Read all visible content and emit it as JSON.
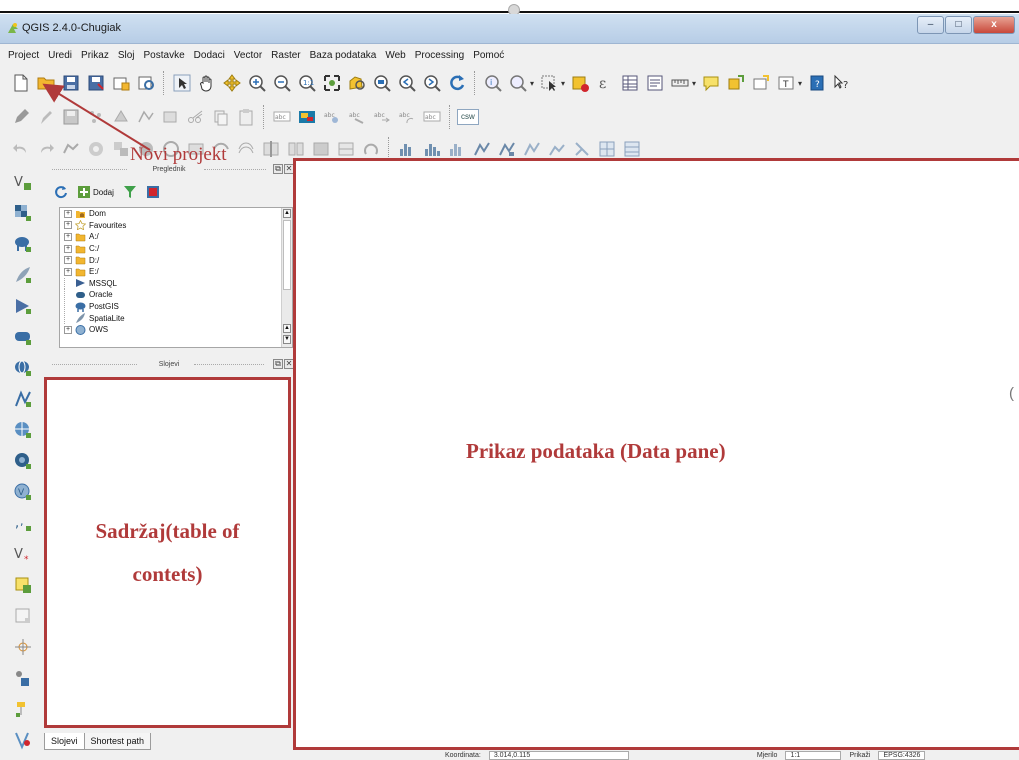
{
  "window": {
    "title": "QGIS 2.4.0-Chugiak",
    "controls": {
      "minimize": "–",
      "maximize": "□",
      "close": "x"
    }
  },
  "menu": [
    "Project",
    "Uredi",
    "Prikaz",
    "Sloj",
    "Postavke",
    "Dodaci",
    "Vector",
    "Raster",
    "Baza podataka",
    "Web",
    "Processing",
    "Pomoć"
  ],
  "toolbar": {
    "csw_label": "csw"
  },
  "browser_panel": {
    "title": "Preglednik",
    "add_label": "Dodaj",
    "items": [
      {
        "label": "Dom",
        "icon": "home-folder-icon",
        "expandable": true
      },
      {
        "label": "Favourites",
        "icon": "star-icon",
        "expandable": true
      },
      {
        "label": "A:/",
        "icon": "folder-icon",
        "expandable": true
      },
      {
        "label": "C:/",
        "icon": "folder-icon",
        "expandable": true
      },
      {
        "label": "D:/",
        "icon": "folder-icon",
        "expandable": true
      },
      {
        "label": "E:/",
        "icon": "folder-icon",
        "expandable": true
      },
      {
        "label": "MSSQL",
        "icon": "mssql-icon",
        "expandable": false
      },
      {
        "label": "Oracle",
        "icon": "oracle-icon",
        "expandable": false
      },
      {
        "label": "PostGIS",
        "icon": "postgis-icon",
        "expandable": false
      },
      {
        "label": "SpatiaLite",
        "icon": "spatialite-icon",
        "expandable": false
      },
      {
        "label": "OWS",
        "icon": "ows-icon",
        "expandable": true
      }
    ]
  },
  "layers_panel": {
    "title": "Slojevi"
  },
  "annotations": {
    "new_project": "Novi projekt",
    "data_pane": "Prikaz podataka (Data pane)",
    "toc_line1": "Sadržaj(table of",
    "toc_line2": "contets)",
    "accent_color": "#b03a3a"
  },
  "bottom_tabs": [
    "Slojevi",
    "Shortest path"
  ],
  "status": {
    "coordinate_label": "Koordinata:",
    "coordinate_value": "3.014,0.115",
    "scale_label": "Mjerilo",
    "scale_value": "1:1",
    "render_label": "Prikaži",
    "crs_label": "EPSG:4326"
  }
}
